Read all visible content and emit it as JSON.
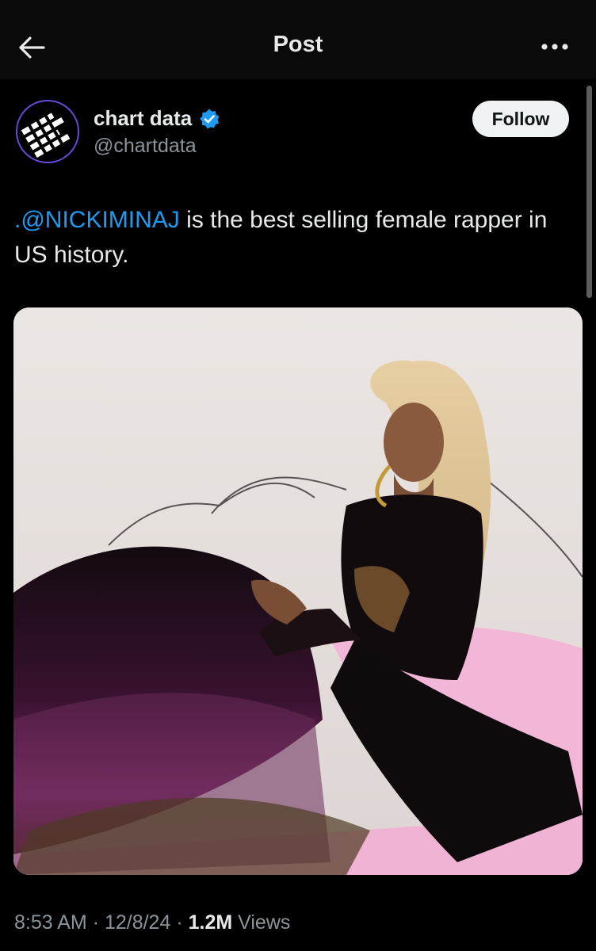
{
  "header": {
    "title": "Post",
    "back_icon": "arrow-left-icon",
    "more_icon": "more-horizontal-icon"
  },
  "author": {
    "name": "chart data",
    "handle": "@chartdata",
    "verified_icon": "verified-badge-icon",
    "verified_color": "#1d9bf0",
    "follow_label": "Follow"
  },
  "post": {
    "mention": ".@NICKIMINAJ",
    "text": " is the best selling female rapper in US history."
  },
  "media": {
    "alt_kind": "photo"
  },
  "meta": {
    "time": "8:53 AM",
    "sep1": " · ",
    "date": "12/8/24",
    "sep2": " · ",
    "views_count": "1.2M",
    "views_label": " Views"
  },
  "colors": {
    "background": "#000000",
    "accent": "#1d9bf0",
    "secondary_text": "#8b949b"
  }
}
